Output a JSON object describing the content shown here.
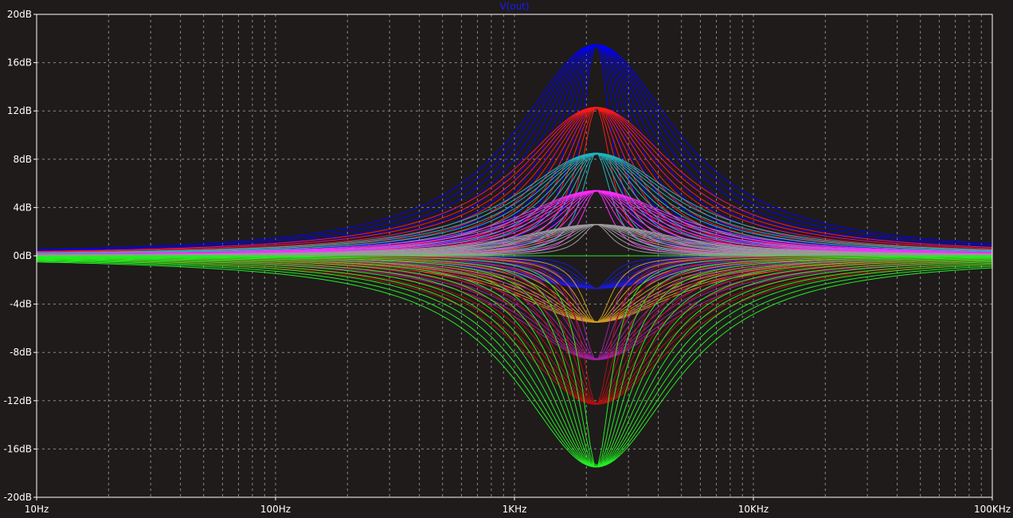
{
  "window": {
    "background": "#1f1b1b",
    "axis_color": "#ffffff",
    "grid_color": "#8a8a8a"
  },
  "chart_data": {
    "type": "line",
    "title": "V(out)",
    "title_color": "#1a1aff",
    "xscale": "log",
    "xlim": [
      10,
      100000
    ],
    "ylim": [
      -20,
      20
    ],
    "grid": true,
    "x_ticks": [
      {
        "value": 10,
        "label": "10Hz"
      },
      {
        "value": 100,
        "label": "100Hz"
      },
      {
        "value": 1000,
        "label": "1KHz"
      },
      {
        "value": 10000,
        "label": "10KHz"
      },
      {
        "value": 100000,
        "label": "100KHz"
      }
    ],
    "y_ticks": [
      {
        "value": 20,
        "label": "20dB"
      },
      {
        "value": 16,
        "label": "16dB"
      },
      {
        "value": 12,
        "label": "12dB"
      },
      {
        "value": 8,
        "label": "8dB"
      },
      {
        "value": 4,
        "label": "4dB"
      },
      {
        "value": 0,
        "label": "0dB"
      },
      {
        "value": -4,
        "label": "-4dB"
      },
      {
        "value": -8,
        "label": "-8dB"
      },
      {
        "value": -12,
        "label": "-12dB"
      },
      {
        "value": -16,
        "label": "-16dB"
      },
      {
        "value": -20,
        "label": "-20dB"
      }
    ],
    "center_frequency": 2200,
    "curve_families": [
      {
        "color": "#0000ff",
        "peak_db": 17.5,
        "octave_widths": [
          0.5,
          0.7,
          0.9,
          1.1,
          1.3,
          1.5,
          1.7,
          1.9,
          2.1,
          2.3,
          2.5,
          2.7
        ]
      },
      {
        "color": "#ff1a1a",
        "peak_db": 12.3,
        "octave_widths": [
          0.5,
          0.7,
          0.9,
          1.1,
          1.3,
          1.5,
          1.7,
          1.9,
          2.1,
          2.3,
          2.5,
          2.7
        ]
      },
      {
        "color": "#1fb5c0",
        "peak_db": 8.5,
        "octave_widths": [
          0.5,
          0.7,
          0.9,
          1.1,
          1.3,
          1.5,
          1.7,
          1.9,
          2.1,
          2.3,
          2.5,
          2.7
        ]
      },
      {
        "color": "#ff2bff",
        "peak_db": 5.4,
        "octave_widths": [
          0.5,
          0.7,
          0.9,
          1.1,
          1.3,
          1.5,
          1.7,
          1.9,
          2.1,
          2.3,
          2.5,
          2.7
        ]
      },
      {
        "color": "#9a9a9a",
        "peak_db": 2.6,
        "octave_widths": [
          0.5,
          0.7,
          0.9,
          1.1,
          1.3,
          1.5,
          1.7,
          1.9,
          2.1,
          2.3,
          2.5,
          2.7
        ]
      },
      {
        "color": "#1a1ad8",
        "peak_db": -2.7,
        "octave_widths": [
          0.5,
          0.7,
          0.9,
          1.1,
          1.3,
          1.5,
          1.7,
          1.9,
          2.1,
          2.3,
          2.5,
          2.7
        ]
      },
      {
        "color": "#d09a20",
        "peak_db": -5.5,
        "octave_widths": [
          0.5,
          0.7,
          0.9,
          1.1,
          1.3,
          1.5,
          1.7,
          1.9,
          2.1,
          2.3,
          2.5,
          2.7
        ]
      },
      {
        "color": "#a020a0",
        "peak_db": -8.6,
        "octave_widths": [
          0.5,
          0.7,
          0.9,
          1.1,
          1.3,
          1.5,
          1.7,
          1.9,
          2.1,
          2.3,
          2.5,
          2.7
        ]
      },
      {
        "color": "#b01010",
        "peak_db": -12.3,
        "octave_widths": [
          0.5,
          0.7,
          0.9,
          1.1,
          1.3,
          1.5,
          1.7,
          1.9,
          2.1,
          2.3,
          2.5,
          2.7
        ]
      },
      {
        "color": "#22ee22",
        "peak_db": -17.5,
        "octave_widths": [
          0.5,
          0.7,
          0.9,
          1.1,
          1.3,
          1.5,
          1.7,
          1.9,
          2.1,
          2.3,
          2.5,
          2.7
        ]
      }
    ]
  }
}
